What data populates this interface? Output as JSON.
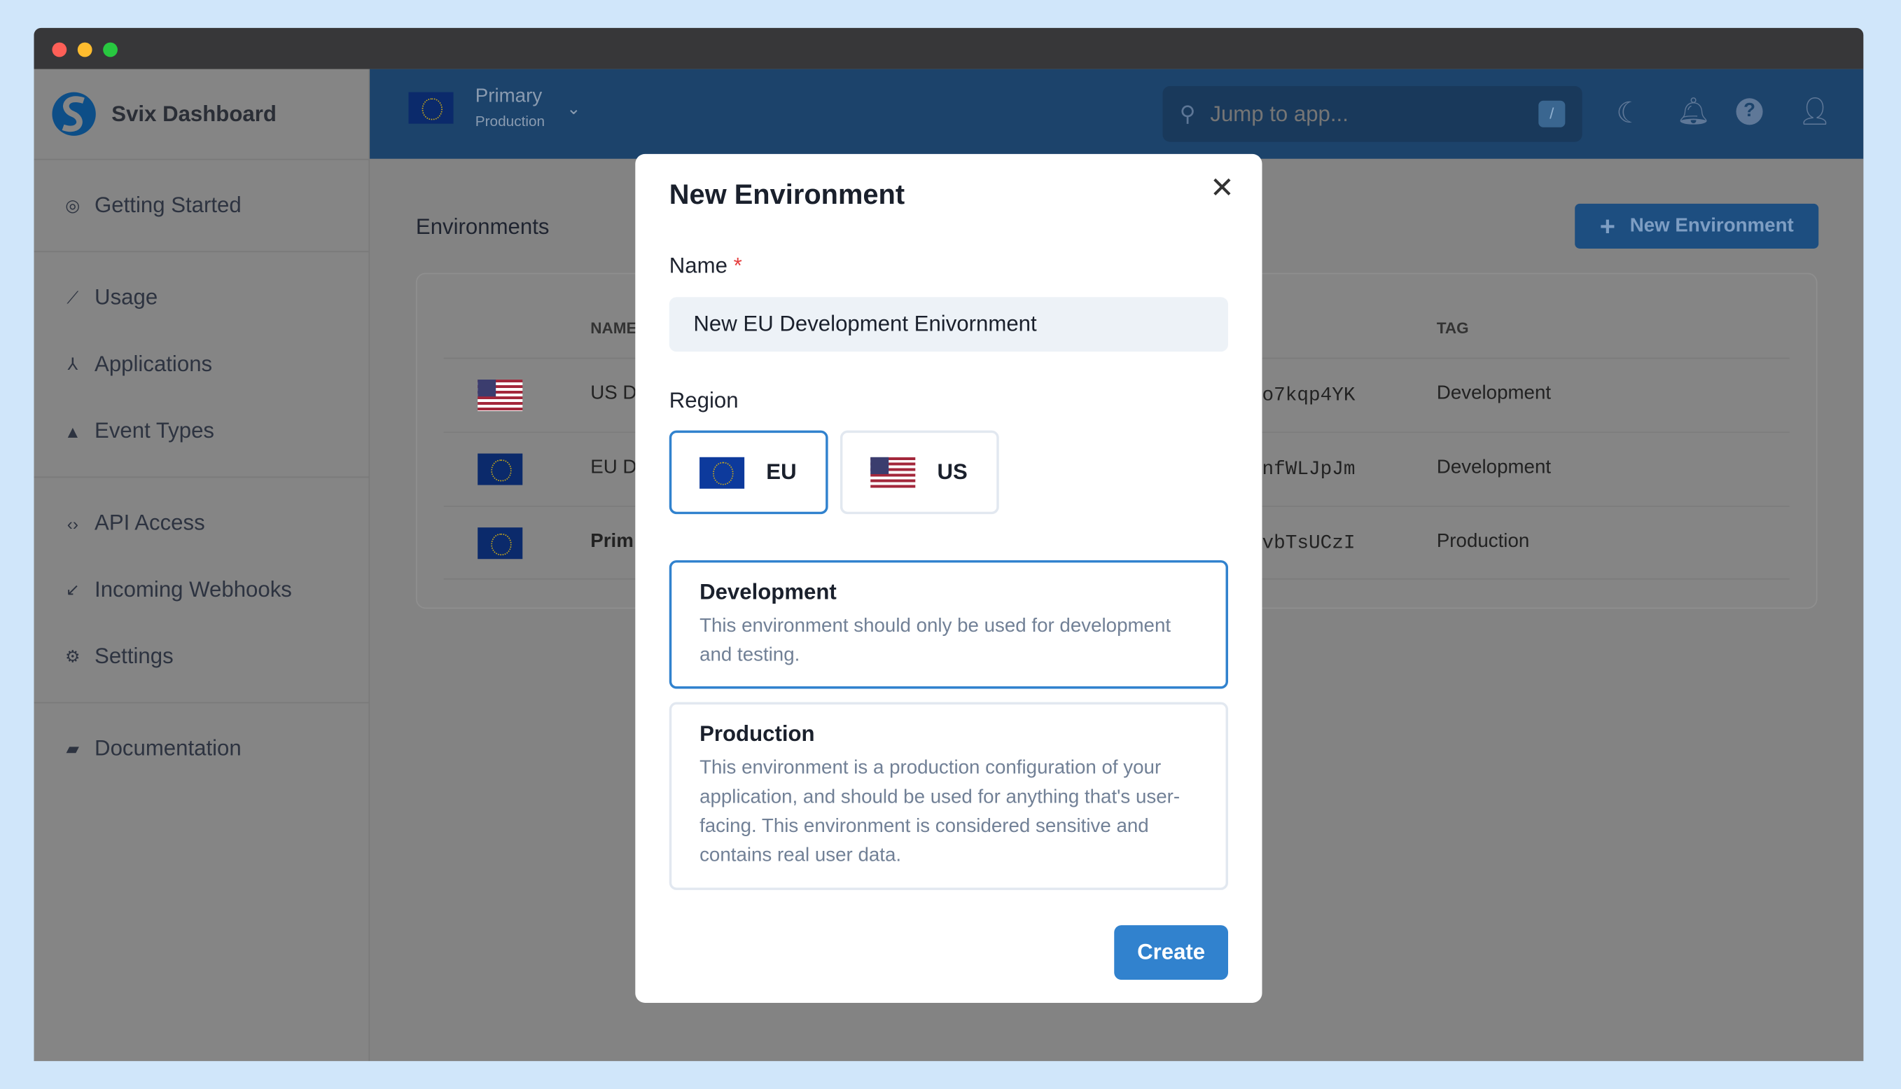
{
  "app": {
    "title": "Svix Dashboard",
    "brand_color": "#1c436b",
    "accent": "#3182ce"
  },
  "header": {
    "env_name": "Primary",
    "env_tag": "Production",
    "search_placeholder": "Jump to app...",
    "search_shortcut": "/"
  },
  "sidebar": {
    "items": [
      {
        "label": "Getting Started",
        "icon": "target-icon"
      },
      {
        "label": "Usage",
        "icon": "chart-line-icon"
      },
      {
        "label": "Applications",
        "icon": "nodes-icon"
      },
      {
        "label": "Event Types",
        "icon": "shapes-icon"
      },
      {
        "label": "API Access",
        "icon": "code-icon"
      },
      {
        "label": "Incoming Webhooks",
        "icon": "arrow-down-left-icon"
      },
      {
        "label": "Settings",
        "icon": "gear-icon"
      },
      {
        "label": "Documentation",
        "icon": "book-icon"
      }
    ]
  },
  "main": {
    "title": "Environments",
    "new_button": "New Environment",
    "columns": [
      "NAME",
      "TAG"
    ],
    "rows": [
      {
        "flag": "us",
        "name": "US D",
        "id": "o7kqp4YK",
        "tag": "Development"
      },
      {
        "flag": "eu",
        "name": "EU D",
        "id": "nfWLJpJm",
        "tag": "Development"
      },
      {
        "flag": "eu",
        "name": "Prim",
        "id": "vbTsUCzI",
        "tag": "Production"
      }
    ]
  },
  "modal": {
    "title": "New Environment",
    "name_label": "Name",
    "required_mark": "*",
    "name_value": "New EU Development Enivornment",
    "region_label": "Region",
    "regions": [
      {
        "label": "EU",
        "selected": true
      },
      {
        "label": "US",
        "selected": false
      }
    ],
    "types": [
      {
        "title": "Development",
        "desc": "This environment should only be used for development and testing.",
        "selected": true
      },
      {
        "title": "Production",
        "desc": "This environment is a production configuration of your application, and should be used for anything that's user-facing. This environment is considered sensitive and contains real user data.",
        "selected": false
      }
    ],
    "create_label": "Create"
  }
}
